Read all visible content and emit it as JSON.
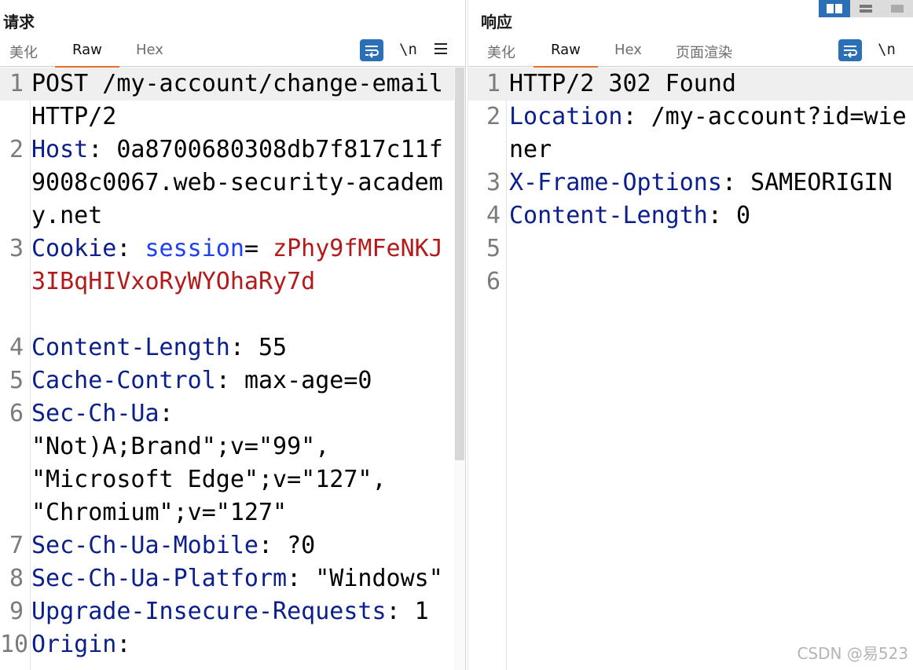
{
  "request": {
    "title": "请求",
    "tabs": [
      {
        "label": "美化",
        "active": false
      },
      {
        "label": "Raw",
        "active": true
      },
      {
        "label": "Hex",
        "active": false
      }
    ],
    "newline_toggle": "\\n",
    "lines": [
      {
        "num": "1",
        "text": "POST /my-account/change-email HTTP/2"
      },
      {
        "num": "2",
        "key": "Host",
        "sep": ":",
        "value": "0a8700680308db7f817c11f9008c0067.web-security-academy.net"
      },
      {
        "num": "3",
        "key": "Cookie",
        "sep": ":",
        "cookie_name": "session",
        "cookie_eq": "=",
        "cookie_value": "zPhy9fMFeNKJ3IBqHIVxoRyWYOhaRy7d"
      },
      {
        "num": "4",
        "key": "Content-Length",
        "sep": ":",
        "value": "55"
      },
      {
        "num": "5",
        "key": "Cache-Control",
        "sep": ":",
        "value": "max-age=0"
      },
      {
        "num": "6",
        "key": "Sec-Ch-Ua",
        "sep": ":",
        "value": "\"Not)A;Brand\";v=\"99\", \"Microsoft Edge\";v=\"127\", \"Chromium\";v=\"127\""
      },
      {
        "num": "7",
        "key": "Sec-Ch-Ua-Mobile",
        "sep": ":",
        "value": "?0"
      },
      {
        "num": "8",
        "key": "Sec-Ch-Ua-Platform",
        "sep": ":",
        "value": "\"Windows\""
      },
      {
        "num": "9",
        "key": "Upgrade-Insecure-Requests",
        "sep": ":",
        "value": "1"
      },
      {
        "num": "10",
        "key": "Origin",
        "sep": ":"
      }
    ]
  },
  "response": {
    "title": "响应",
    "tabs": [
      {
        "label": "美化",
        "active": false
      },
      {
        "label": "Raw",
        "active": true
      },
      {
        "label": "Hex",
        "active": false
      },
      {
        "label": "页面渲染",
        "active": false
      }
    ],
    "newline_toggle": "\\n",
    "lines": [
      {
        "num": "1",
        "text": "HTTP/2 302 Found"
      },
      {
        "num": "2",
        "key": "Location",
        "sep": ":",
        "value": "/my-account?id=wiener"
      },
      {
        "num": "3",
        "key": "X-Frame-Options",
        "sep": ":",
        "value": "SAMEORIGIN"
      },
      {
        "num": "4",
        "key": "Content-Length",
        "sep": ":",
        "value": "0"
      },
      {
        "num": "5"
      },
      {
        "num": "6"
      }
    ]
  },
  "watermark": "CSDN @易523",
  "colors": {
    "header_key": "#0b1f8c",
    "cookie_name": "#1f3ff0",
    "cookie_value": "#b51a1a",
    "accent": "#2b6fb7",
    "active_tab_underline": "#e8702a"
  }
}
